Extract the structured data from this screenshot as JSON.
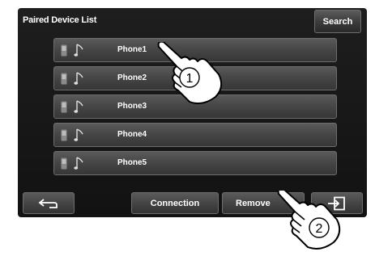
{
  "header": {
    "title": "Paired Device List",
    "search_label": "Search"
  },
  "devices": [
    {
      "name": "Phone1",
      "phone_icon": "phone-icon",
      "audio_icon": "music-note-icon"
    },
    {
      "name": "Phone2",
      "phone_icon": "phone-icon",
      "audio_icon": "music-note-icon"
    },
    {
      "name": "Phone3",
      "phone_icon": "phone-icon",
      "audio_icon": "music-note-icon"
    },
    {
      "name": "Phone4",
      "phone_icon": "phone-icon",
      "audio_icon": "music-note-icon"
    },
    {
      "name": "Phone5",
      "phone_icon": "phone-icon",
      "audio_icon": "music-note-icon"
    }
  ],
  "footer": {
    "back_icon": "return-arrow-icon",
    "connection_label": "Connection",
    "remove_label": "Remove",
    "exit_icon": "exit-door-icon"
  },
  "callouts": [
    {
      "step": "1",
      "icon": "pointing-hand-icon"
    },
    {
      "step": "2",
      "icon": "pointing-hand-icon"
    }
  ],
  "colors": {
    "screen_bg": "#161616",
    "button_bg": "#474747",
    "text": "#ffffff"
  }
}
